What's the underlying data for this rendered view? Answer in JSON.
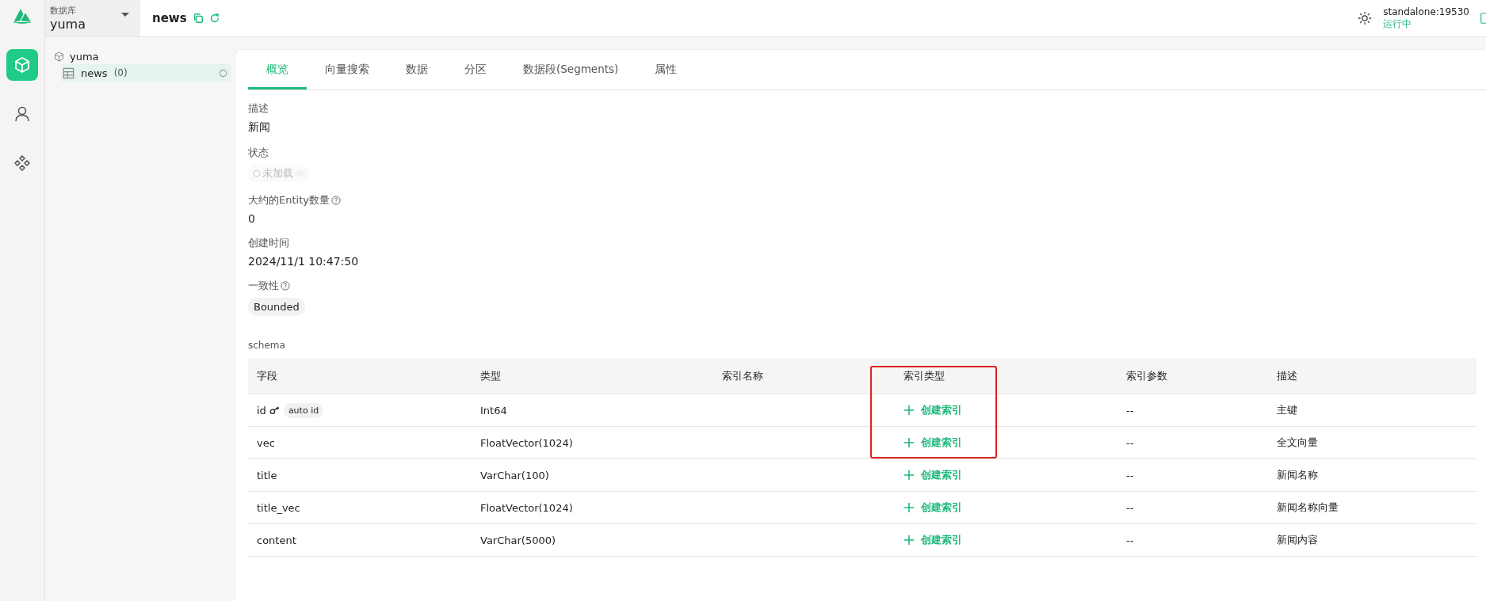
{
  "rail": [
    {
      "kind": "database",
      "selected": true
    },
    {
      "kind": "user",
      "selected": false
    },
    {
      "kind": "system",
      "selected": false
    }
  ],
  "db_selector": {
    "label": "数据库",
    "value": "yuma"
  },
  "header": {
    "title": "news"
  },
  "server": {
    "name": "standalone:19530",
    "status": "运行中"
  },
  "tree": {
    "name": "yuma",
    "children": [
      {
        "name": "news",
        "count": "(0)",
        "selected": true
      }
    ]
  },
  "tabs": [
    {
      "label": "概览",
      "selected": true
    },
    {
      "label": "向量搜索",
      "selected": false
    },
    {
      "label": "数据",
      "selected": false
    },
    {
      "label": "分区",
      "selected": false
    },
    {
      "label": "数据段(Segments)",
      "selected": false
    },
    {
      "label": "属性",
      "selected": false
    }
  ],
  "overview": [
    {
      "kind": "text",
      "label": "描述",
      "help": false,
      "value": "新闻"
    },
    {
      "kind": "status",
      "label": "状态",
      "help": false,
      "value": "未加载"
    },
    {
      "kind": "text",
      "label": "大约的Entity数量",
      "help": true,
      "value": "0"
    },
    {
      "kind": "text",
      "label": "创建时间",
      "help": false,
      "value": "2024/11/1 10:47:50"
    },
    {
      "kind": "chip",
      "label": "一致性",
      "help": true,
      "value": "Bounded"
    }
  ],
  "schema": {
    "title": "schema",
    "columns": [
      "字段",
      "类型",
      "索引名称",
      "索引类型",
      "索引参数",
      "描述"
    ],
    "rows": [
      {
        "field": "id",
        "primary_key": true,
        "badge": "auto id",
        "type": "Int64",
        "index_action": "创建索引",
        "params": "--",
        "description": "主键",
        "highlighted": true
      },
      {
        "field": "vec",
        "primary_key": false,
        "type": "FloatVector(1024)",
        "index_action": "创建索引",
        "params": "--",
        "description": "全文向量",
        "highlighted": true
      },
      {
        "field": "title",
        "primary_key": false,
        "type": "VarChar(100)",
        "index_action": "创建索引",
        "params": "--",
        "description": "新闻名称",
        "highlighted": false
      },
      {
        "field": "title_vec",
        "primary_key": false,
        "type": "FloatVector(1024)",
        "index_action": "创建索引",
        "params": "--",
        "description": "新闻名称向量",
        "highlighted": false
      },
      {
        "field": "content",
        "primary_key": false,
        "type": "VarChar(5000)",
        "index_action": "创建索引",
        "params": "--",
        "description": "新闻内容",
        "highlighted": false
      }
    ]
  }
}
